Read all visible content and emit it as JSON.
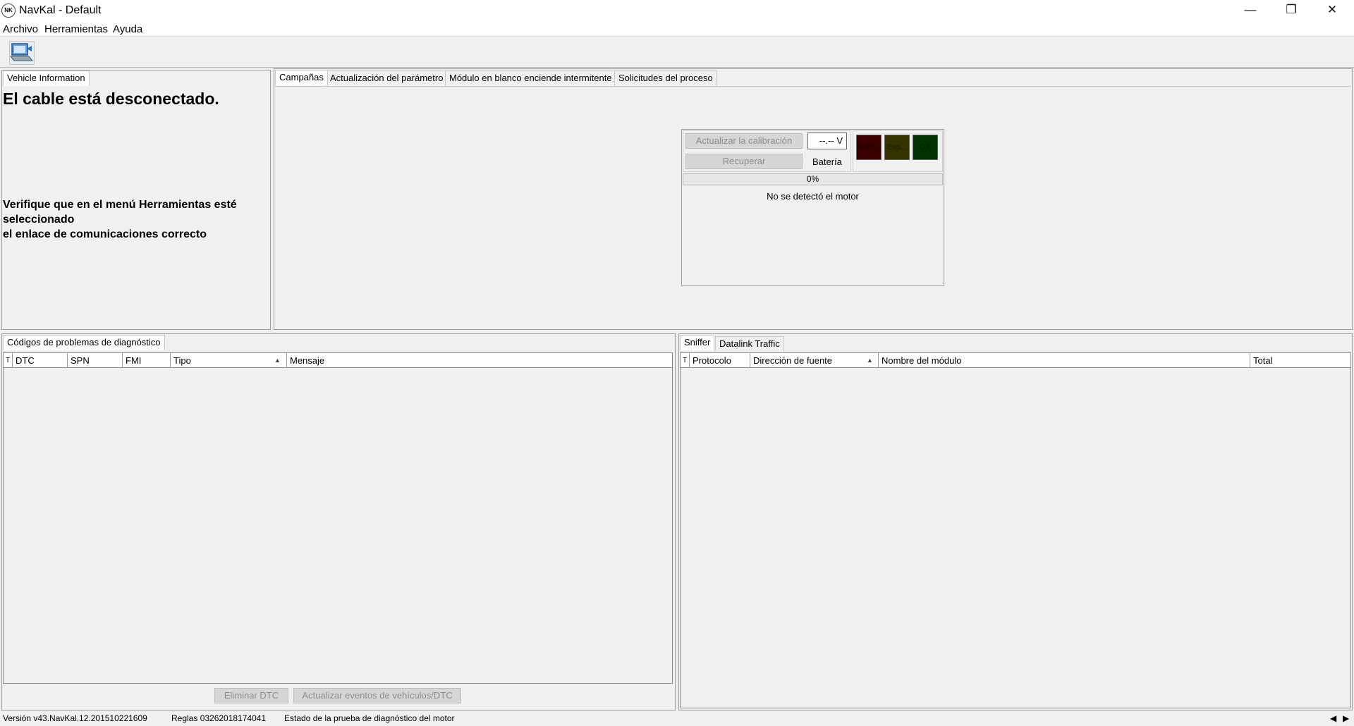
{
  "window": {
    "title": "NavKal - Default",
    "app_icon_text": "NK",
    "minimize": "—",
    "maximize": "❐",
    "close": "✕"
  },
  "menu": {
    "items": [
      "Archivo",
      "Herramientas",
      "Ayuda"
    ]
  },
  "vehicle_info": {
    "tab": "Vehicle Information",
    "headline": "El cable está desconectado.",
    "instructions": [
      "Verifique que en el menú Herramientas esté",
      "seleccionado",
      "el enlace de comunicaciones correcto"
    ]
  },
  "main_tabs": [
    "Campañas",
    "Actualización del parámetro",
    "Módulo en blanco enciende intermitente",
    "Solicitudes del proceso"
  ],
  "calibration": {
    "update_button": "Actualizar la calibración",
    "recover_button": "Recuperar",
    "voltage": "--.-- V",
    "battery_label": "Batería",
    "lights": [
      {
        "label": "Error",
        "color": "#3a0000"
      },
      {
        "label": "Esp...",
        "color": "#333300"
      },
      {
        "label": "OK",
        "color": "#003300"
      }
    ],
    "progress": 0,
    "progress_text": "0%",
    "status": "No se detectó el motor"
  },
  "dtc": {
    "tab": "Códigos de problemas de diagnóstico",
    "filter_icon": "T",
    "columns": [
      "DTC",
      "SPN",
      "FMI",
      "Tipo",
      "Mensaje"
    ],
    "sort_icon": "▲",
    "rows": [],
    "delete_button": "Eliminar DTC",
    "update_events_button": "Actualizar eventos de vehículos/DTC"
  },
  "sniffer": {
    "tabs": [
      "Sniffer",
      "Datalink Traffic"
    ],
    "filter_icon": "T",
    "columns": [
      "Protocolo",
      "Dirección de fuente",
      "Nombre del módulo",
      "Total"
    ],
    "sort_icon": "▲",
    "rows": []
  },
  "status_bar": {
    "version": "Versión v43.NavKal.12.201510221609",
    "rules": "Reglas 03262018174041",
    "test_state": "Estado de la prueba de diagnóstico del motor",
    "scroll_left": "◀",
    "scroll_right": "▶"
  },
  "colors": {
    "background": "#f0f0f0",
    "light_error": "#3a0000",
    "light_wait": "#333300",
    "light_ok": "#003300"
  }
}
